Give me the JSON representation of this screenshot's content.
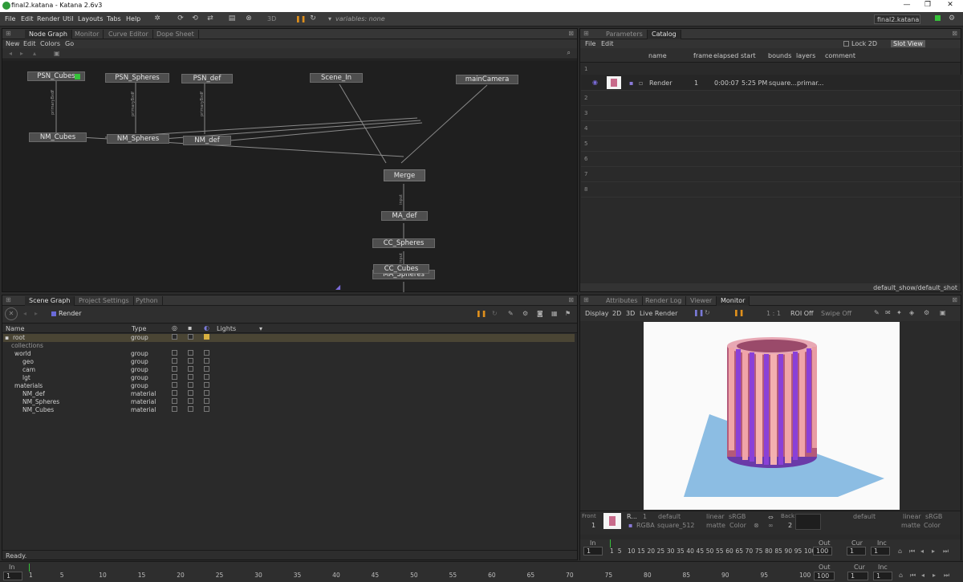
{
  "window": {
    "title": "final2.katana - Katana 2.6v3",
    "min": "—",
    "max": "❐",
    "close": "✕"
  },
  "menu": {
    "items": [
      "File",
      "Edit",
      "Render",
      "Util",
      "Layouts",
      "Tabs",
      "Help"
    ],
    "render_3d": "3D",
    "variables": "variables: none",
    "project_select": "final2.katana"
  },
  "node_graph": {
    "tabs": [
      "Node Graph",
      "Monitor",
      "Curve Editor",
      "Dope Sheet"
    ],
    "menu": [
      "New",
      "Edit",
      "Colors",
      "Go"
    ],
    "nodes": {
      "psn_cubes": "PSN_Cubes",
      "psn_spheres": "PSN_Spheres",
      "psn_def": "PSN_def",
      "scene_in": "Scene_In",
      "main_camera": "mainCamera",
      "nm_cubes": "NM_Cubes",
      "nm_spheres": "NM_Spheres",
      "nm_def": "NM_def",
      "merge": "Merge",
      "ma_def": "MA_def",
      "cc_spheres": "CC_Spheres",
      "ma_spheres": "MA_Spheres",
      "cc_cubes": "CC_Cubes"
    },
    "port_labels": {
      "primary": "primaryBxdf",
      "input": "input"
    }
  },
  "catalog": {
    "tabs": [
      "Parameters",
      "Catalog"
    ],
    "menu": [
      "File",
      "Edit"
    ],
    "lock_2d": "Lock 2D",
    "slot_view": "Slot View",
    "columns": [
      "name",
      "frame",
      "elapsed",
      "start",
      "bounds",
      "layers",
      "comment"
    ],
    "slots": [
      "1",
      "2",
      "3",
      "4",
      "5",
      "6",
      "7",
      "8"
    ],
    "render_row": {
      "name": "Render",
      "frame": "1",
      "elapsed": "0:00:07",
      "start": "5:25 PM",
      "bounds": "square...",
      "layers": "primar..."
    },
    "footer": "default_show/default_shot"
  },
  "scene_graph": {
    "tabs": [
      "Scene Graph",
      "Project Settings",
      "Python"
    ],
    "render_label": "Render",
    "columns": {
      "name": "Name",
      "type": "Type",
      "lights": "Lights"
    },
    "rows": [
      {
        "name": "root",
        "type": "group"
      },
      {
        "name": "collections",
        "type": ""
      },
      {
        "name": "world",
        "type": "group"
      },
      {
        "name": "geo",
        "type": "group"
      },
      {
        "name": "cam",
        "type": "group"
      },
      {
        "name": "lgt",
        "type": "group"
      },
      {
        "name": "materials",
        "type": "group"
      },
      {
        "name": "NM_def",
        "type": "material"
      },
      {
        "name": "NM_Spheres",
        "type": "material"
      },
      {
        "name": "NM_Cubes",
        "type": "material"
      }
    ],
    "status": "Ready."
  },
  "monitor": {
    "tabs": [
      "Attributes",
      "Render Log",
      "Viewer",
      "Monitor"
    ],
    "toolbar": [
      "Display",
      "2D",
      "3D",
      "Live Render"
    ],
    "ratio": "1 : 1",
    "roi": "ROI Off",
    "swipe": "Swipe Off",
    "front_label": "Front",
    "front_num": "1",
    "back_label": "Back",
    "back_num": "2",
    "front_info": {
      "name": "R...",
      "num": "1",
      "channels": "RGBA",
      "res": "square_512",
      "color1": "default",
      "lin": "linear",
      "srgb": "sRGB",
      "matte": "matte",
      "color": "Color"
    },
    "back_info": {
      "color1": "default",
      "lin": "linear",
      "srgb": "sRGB",
      "matte": "matte",
      "color": "Color"
    }
  },
  "monitor_timeline": {
    "in_label": "In",
    "out_label": "Out",
    "cur_label": "Cur",
    "inc_label": "Inc",
    "in_value": "1",
    "out_value": "100",
    "cur_value": "1",
    "inc_value": "1",
    "ticks": [
      "1",
      "5",
      "10",
      "15",
      "20",
      "25",
      "30",
      "35",
      "40",
      "45",
      "50",
      "55",
      "60",
      "65",
      "70",
      "75",
      "80",
      "85",
      "90",
      "95",
      "100"
    ]
  },
  "main_timeline": {
    "in_label": "In",
    "out_label": "Out",
    "cur_label": "Cur",
    "inc_label": "Inc",
    "in_value": "1",
    "out_value": "100",
    "cur_value": "1",
    "inc_value": "1",
    "ticks": [
      "1",
      "5",
      "10",
      "15",
      "20",
      "25",
      "30",
      "35",
      "40",
      "45",
      "50",
      "55",
      "60",
      "65",
      "70",
      "75",
      "80",
      "85",
      "90",
      "95",
      "100"
    ]
  },
  "colors": {
    "accent": "#e0901c",
    "node_green": "#36c23a",
    "bg": "#2a2a2a"
  }
}
